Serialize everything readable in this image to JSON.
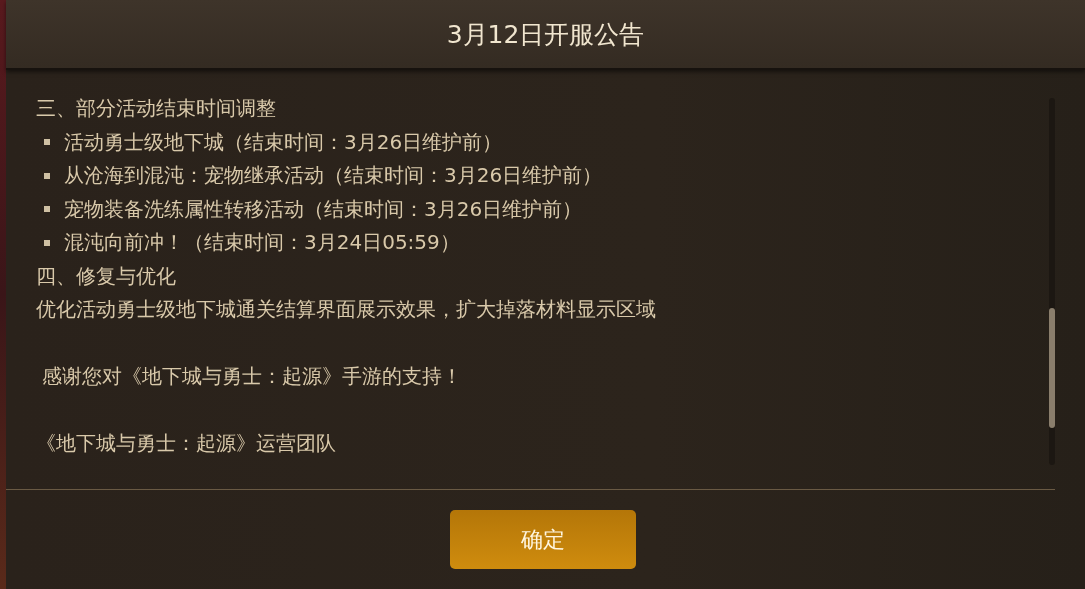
{
  "dialog": {
    "title": "3月12日开服公告",
    "lines": [
      {
        "kind": "heading",
        "text": "三、部分活动结束时间调整"
      },
      {
        "kind": "bullet",
        "text": "活动勇士级地下城（结束时间：3月26日维护前）"
      },
      {
        "kind": "bullet",
        "text": "从沧海到混沌：宠物继承活动（结束时间：3月26日维护前）"
      },
      {
        "kind": "bullet",
        "text": "宠物装备洗练属性转移活动（结束时间：3月26日维护前）"
      },
      {
        "kind": "bullet",
        "text": "混沌向前冲！（结束时间：3月24日05:59）"
      },
      {
        "kind": "heading",
        "text": "四、修复与优化"
      },
      {
        "kind": "paragraph",
        "text": "优化活动勇士级地下城通关结算界面展示效果，扩大掉落材料显示区域"
      },
      {
        "kind": "thanks",
        "text": "感谢您对《地下城与勇士：起源》手游的支持！"
      },
      {
        "kind": "signature",
        "text": "《地下城与勇士：起源》运营团队"
      }
    ],
    "confirm_button": "确定"
  }
}
